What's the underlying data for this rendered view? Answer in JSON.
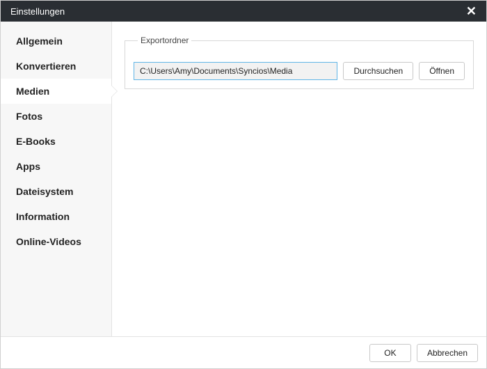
{
  "window": {
    "title": "Einstellungen",
    "close_glyph": "✕"
  },
  "sidebar": {
    "items": [
      {
        "label": "Allgemein"
      },
      {
        "label": "Konvertieren"
      },
      {
        "label": "Medien"
      },
      {
        "label": "Fotos"
      },
      {
        "label": "E-Books"
      },
      {
        "label": "Apps"
      },
      {
        "label": "Dateisystem"
      },
      {
        "label": "Information"
      },
      {
        "label": "Online-Videos"
      }
    ],
    "active_index": 2
  },
  "main": {
    "group_label": "Exportordner",
    "path_value": "C:\\Users\\Amy\\Documents\\Syncios\\Media",
    "browse_label": "Durchsuchen",
    "open_label": "Öffnen"
  },
  "footer": {
    "ok_label": "OK",
    "cancel_label": "Abbrechen"
  },
  "colors": {
    "titlebar_bg": "#2a2e33",
    "sidebar_bg": "#f7f7f7",
    "input_border_focus": "#5fb4e6"
  }
}
